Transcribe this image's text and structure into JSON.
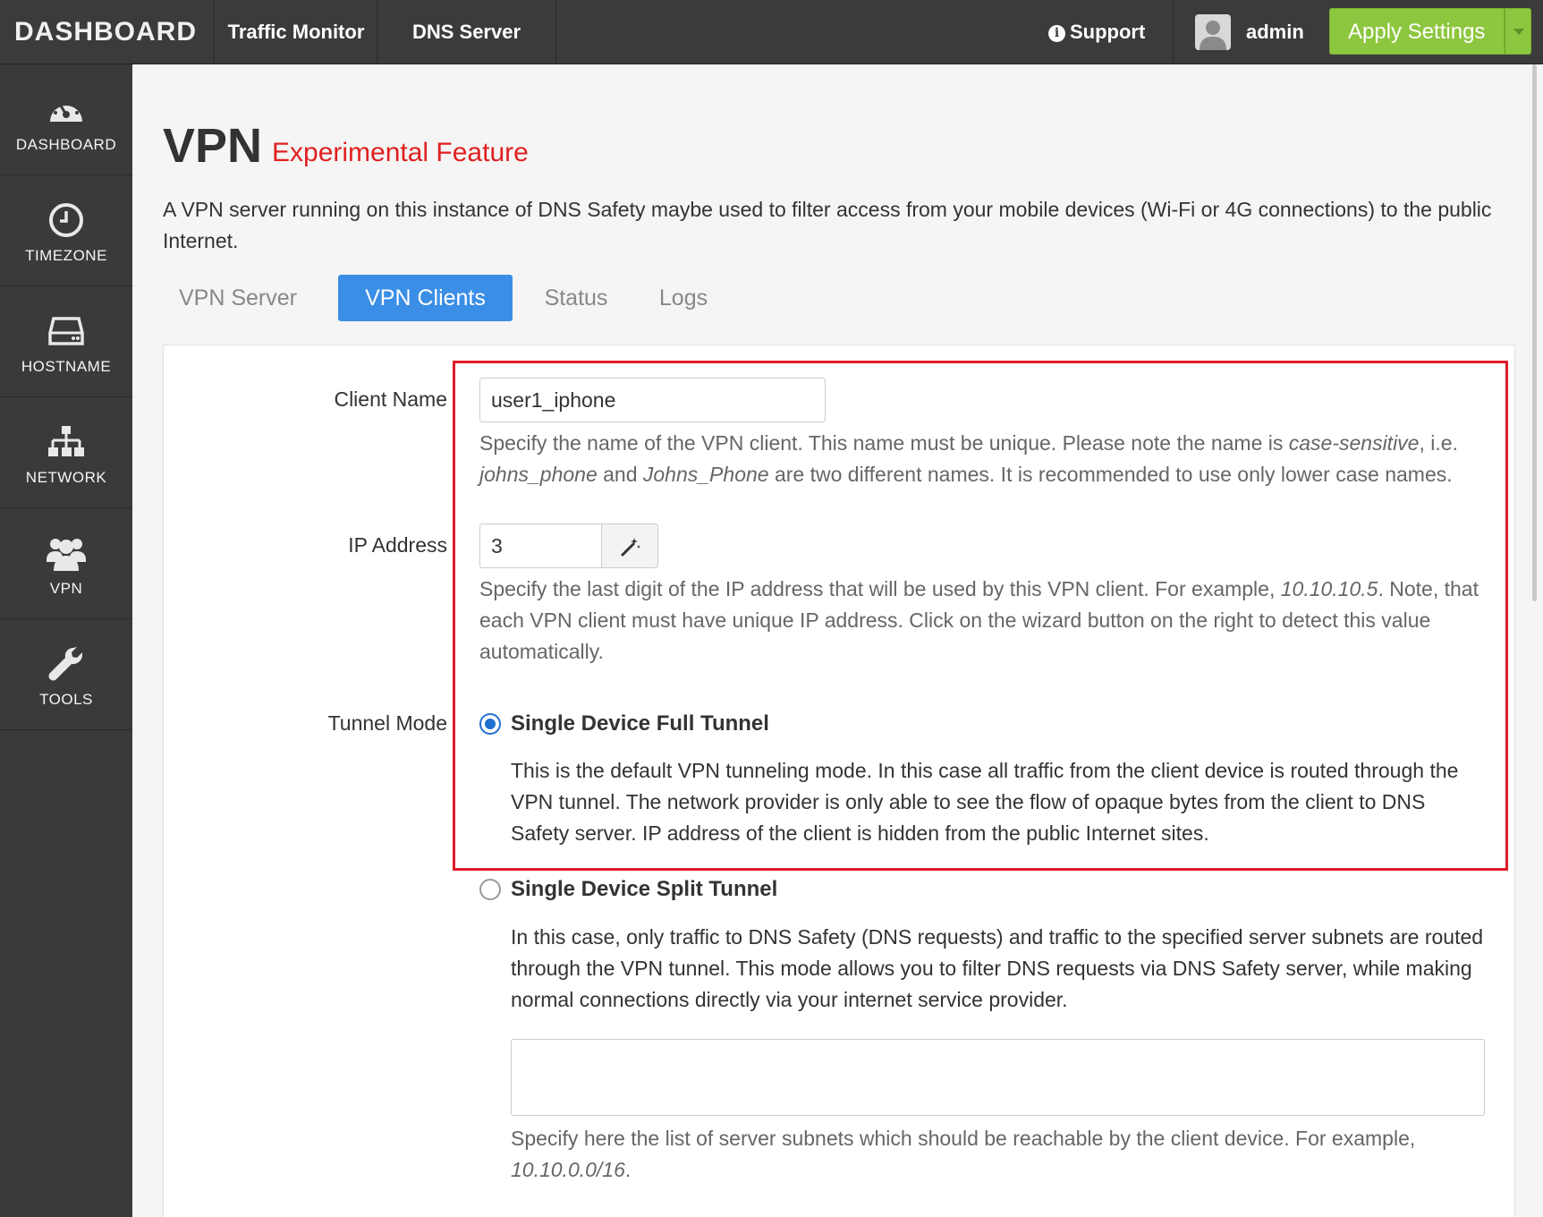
{
  "header": {
    "brand": "DASHBOARD",
    "nav": [
      "Traffic Monitor",
      "DNS Server"
    ],
    "support": "Support",
    "user": "admin",
    "apply_label": "Apply Settings"
  },
  "sidebar": {
    "items": [
      {
        "label": "DASHBOARD",
        "icon": "gauge-icon"
      },
      {
        "label": "TIMEZONE",
        "icon": "clock-icon"
      },
      {
        "label": "HOSTNAME",
        "icon": "hard-drive-icon"
      },
      {
        "label": "NETWORK",
        "icon": "sitemap-icon"
      },
      {
        "label": "VPN",
        "icon": "users-icon"
      },
      {
        "label": "TOOLS",
        "icon": "wrench-icon"
      }
    ]
  },
  "page": {
    "title": "VPN",
    "badge": "Experimental Feature",
    "intro": "A VPN server running on this instance of DNS Safety maybe used to filter access from your mobile devices (Wi-Fi or 4G connections) to the public Internet."
  },
  "tabs": [
    {
      "label": "VPN Server",
      "active": false
    },
    {
      "label": "VPN Clients",
      "active": true
    },
    {
      "label": "Status",
      "active": false
    },
    {
      "label": "Logs",
      "active": false
    }
  ],
  "form": {
    "client_name": {
      "label": "Client Name",
      "value": "user1_iphone",
      "help_a": "Specify the name of the VPN client. This name must be unique. Please note the name is ",
      "help_em1": "case-sensitive",
      "help_b": ", i.e.",
      "help_em2": "johns_phone",
      "help_c": " and ",
      "help_em3": "Johns_Phone",
      "help_d": " are two different names. It is recommended to use only lower case names."
    },
    "ip_address": {
      "label": "IP Address",
      "value": "3",
      "help_a": "Specify the last digit of the IP address that will be used by this VPN client. For example, ",
      "help_em": "10.10.10.5",
      "help_b": ". Note, that each VPN client must have unique IP address. Click on the wizard button on the right to detect this value automatically."
    },
    "tunnel_mode": {
      "label": "Tunnel Mode",
      "options": [
        {
          "label": "Single Device Full Tunnel",
          "checked": true,
          "description": "This is the default VPN tunneling mode. In this case all traffic from the client device is routed through the VPN tunnel. The network provider is only able to see the flow of opaque bytes from the client to DNS Safety server. IP address of the client is hidden from the public Internet sites."
        },
        {
          "label": "Single Device Split Tunnel",
          "checked": false,
          "description": "In this case, only traffic to DNS Safety (DNS requests) and traffic to the specified server subnets are routed through the VPN tunnel. This mode allows you to filter DNS requests via DNS Safety server, while making normal connections directly via your internet service provider."
        }
      ],
      "subnets_value": "",
      "subnets_help_a": "Specify here the list of server subnets which should be reachable by the client device. For example, ",
      "subnets_help_em": "10.10.0.0/16",
      "subnets_help_b": "."
    }
  },
  "colors": {
    "accent": "#3a8ee6",
    "apply": "#8dc63f",
    "experimental": "#e02020",
    "highlight": "#e01b2b",
    "sidebar": "#3a3a3a"
  }
}
